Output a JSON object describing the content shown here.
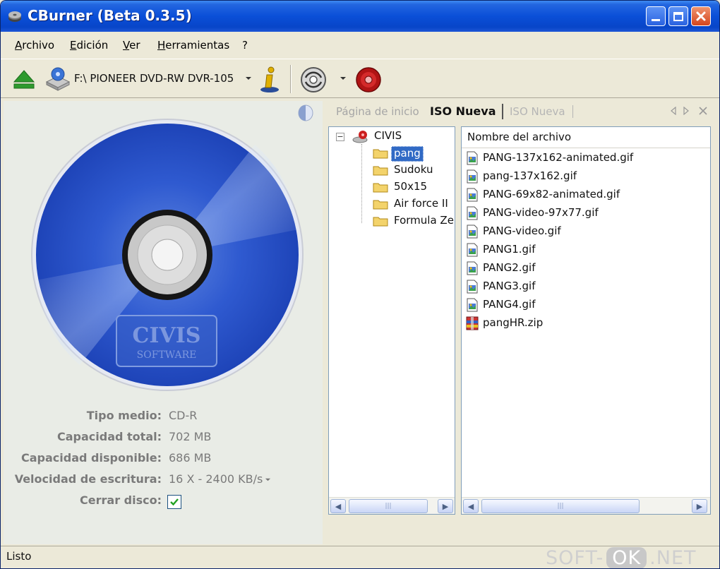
{
  "window": {
    "title": "CBurner (Beta 0.3.5)"
  },
  "menu": {
    "items": [
      "Archivo",
      "Edición",
      "Ver",
      "Herramientas",
      "?"
    ]
  },
  "toolbar": {
    "drive": "F:\\ PIONEER DVD-RW  DVR-105"
  },
  "disc": {
    "logo_line1": "CIVIS",
    "logo_line2": "SOFTWARE"
  },
  "info": {
    "media_type_label": "Tipo medio:",
    "media_type_value": "CD-R",
    "total_capacity_label": "Capacidad total:",
    "total_capacity_value": "702 MB",
    "available_capacity_label": "Capacidad disponible:",
    "available_capacity_value": "686 MB",
    "write_speed_label": "Velocidad de escritura:",
    "write_speed_value": "16 X - 2400 KB/s",
    "close_disc_label": "Cerrar disco:",
    "close_disc_checked": true
  },
  "tabs": [
    {
      "label": "Página de inicio",
      "state": "inactive"
    },
    {
      "label": "ISO Nueva",
      "state": "active"
    },
    {
      "label": "ISO Nueva",
      "state": "disabled"
    }
  ],
  "tree": {
    "root": "CIVIS",
    "children": [
      "pang",
      "Sudoku",
      "50x15",
      "Air force II",
      "Formula Zer"
    ],
    "selected": "pang"
  },
  "files": {
    "header": "Nombre del archivo",
    "items": [
      {
        "name": "PANG-137x162-animated.gif",
        "type": "gif"
      },
      {
        "name": "pang-137x162.gif",
        "type": "gif"
      },
      {
        "name": "PANG-69x82-animated.gif",
        "type": "gif"
      },
      {
        "name": "PANG-video-97x77.gif",
        "type": "gif"
      },
      {
        "name": "PANG-video.gif",
        "type": "gif"
      },
      {
        "name": "PANG1.gif",
        "type": "gif"
      },
      {
        "name": "PANG2.gif",
        "type": "gif"
      },
      {
        "name": "PANG3.gif",
        "type": "gif"
      },
      {
        "name": "PANG4.gif",
        "type": "gif"
      },
      {
        "name": "pangHR.zip",
        "type": "zip"
      }
    ]
  },
  "status": {
    "text": "Listo"
  },
  "watermark": {
    "left": "SOFT-",
    "middle": "OK",
    "right": ".NET"
  },
  "colors": {
    "titlebar": "#0a4fd8",
    "disc_blue": "#2a55c8",
    "selection": "#316ac5",
    "checkmark": "#21a121"
  }
}
